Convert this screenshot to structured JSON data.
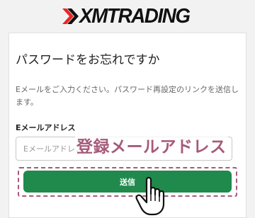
{
  "brand": {
    "logo_text": "XMTRADING",
    "accent": "#e8252a"
  },
  "page": {
    "title": "パスワードをお忘れですか",
    "description": "Eメールをご入力ください。パスワード再設定のリンクを送信します。"
  },
  "form": {
    "email_label": "Eメールアドレス",
    "email_placeholder": "Eメールアドレス",
    "email_value": "",
    "submit_label": "送信",
    "submit_color": "#1f8a4c"
  },
  "annotation": {
    "label": "登録メールアドレス",
    "color": "#a65a7a"
  },
  "cursor": {
    "icon": "hand-pointer-icon"
  }
}
